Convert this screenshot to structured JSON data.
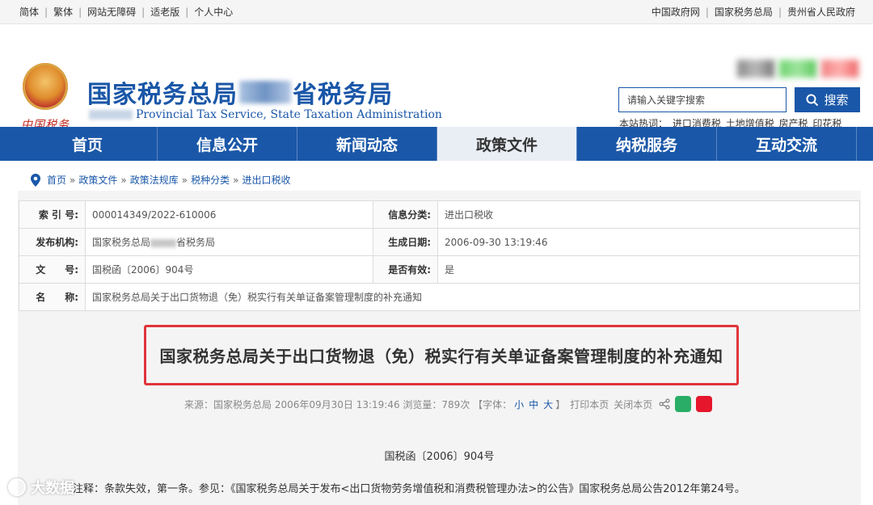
{
  "topbar": {
    "left": [
      "简体",
      "繁体",
      "网站无障碍",
      "适老版",
      "个人中心"
    ],
    "right": [
      "中国政府网",
      "国家税务总局",
      "贵州省人民政府"
    ]
  },
  "header": {
    "title_left": "国家税务总局",
    "title_right": "省税务局",
    "subtitle": "Provincial Tax Service, State Taxation Administration",
    "emblem_text": "中国税务"
  },
  "search": {
    "placeholder": "请输入关键字搜索",
    "button_label": "搜索"
  },
  "hot": {
    "label": "本站热词：",
    "items": [
      "进口消费税",
      "土地增值税",
      "房产税",
      "印花税"
    ]
  },
  "nav": {
    "items": [
      "首页",
      "信息公开",
      "新闻动态",
      "政策文件",
      "纳税服务",
      "互动交流"
    ],
    "active_index": 3
  },
  "breadcrumb": [
    "首页",
    "政策文件",
    "政策法规库",
    "税种分类",
    "进出口税收"
  ],
  "meta": {
    "index_label": "索 引 号:",
    "index_value": "000014349/2022-610006",
    "category_label": "信息分类:",
    "category_value": "进出口税收",
    "publisher_label": "发布机构:",
    "publisher_value_left": "国家税务总局",
    "publisher_value_right": "省税务局",
    "date_label": "生成日期:",
    "date_value": "2006-09-30 13:19:46",
    "docnum_label": "文　　号:",
    "docnum_value": "国税函〔2006〕904号",
    "valid_label": "是否有效:",
    "valid_value": "是",
    "name_label": "名　　称:",
    "name_value": "国家税务总局关于出口货物退（免）税实行有关单证备案管理制度的补充通知"
  },
  "article": {
    "title": "国家税务总局关于出口货物退（免）税实行有关单证备案管理制度的补充通知",
    "source_text": "来源：国家税务总局 2006年09月30日 13:19:46 浏览量：789次 【字体：",
    "font_small": "小",
    "font_medium": "中",
    "font_large": "大",
    "font_close": "】",
    "print_label": "打印本页",
    "close_label": "关闭本页",
    "doc_number": "国税函〔2006〕904号",
    "note": "注释：条款失效，第一条。参见：《国家税务总局关于发布<出口货物劳务增值税和消费税管理办法>的公告》国家税务总局公告2012年第24号。"
  },
  "watermark": "大数据"
}
